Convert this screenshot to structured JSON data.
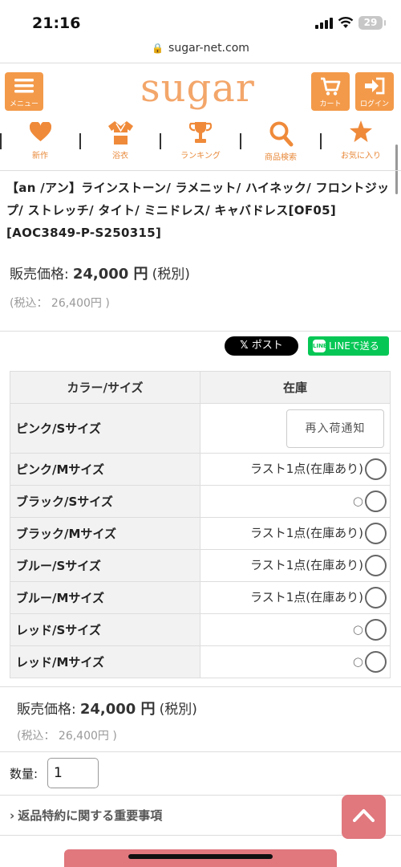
{
  "status_bar": {
    "time": "21:16",
    "battery": "29"
  },
  "browser": {
    "url": "sugar-net.com"
  },
  "header": {
    "menu_label": "メニュー",
    "logo": "sugar",
    "cart_label": "カート",
    "login_label": "ログイン"
  },
  "nav": {
    "items": [
      {
        "label": "新作",
        "icon": "heart-icon"
      },
      {
        "label": "浴衣",
        "icon": "yukata-icon"
      },
      {
        "label": "ランキング",
        "icon": "trophy-icon"
      },
      {
        "label": "商品検索",
        "icon": "search-icon"
      },
      {
        "label": "お気に入り",
        "icon": "star-icon"
      }
    ]
  },
  "product": {
    "title": "【an /アン】ラインストーン/ ラメニット/ ハイネック/ フロントジップ/ ストレッチ/ タイト/ ミニドレス/ キャバドレス[OF05][AOC3849-P-S250315]",
    "price_label": "販売価格:",
    "price": "24,000 円",
    "price_note": "(税別)",
    "tax_label": "(税込：",
    "tax_price": "26,400円",
    "tax_close": ")"
  },
  "share": {
    "x_post": "ポスト",
    "line": "LINEで送る"
  },
  "stock_table": {
    "headers": [
      "カラー/サイズ",
      "在庫"
    ],
    "rows": [
      {
        "name": "ピンク/Sサイズ",
        "stock": "",
        "button": "再入荷通知"
      },
      {
        "name": "ピンク/Mサイズ",
        "stock": "ラスト1点(在庫あり)"
      },
      {
        "name": "ブラック/Sサイズ",
        "stock": "○"
      },
      {
        "name": "ブラック/Mサイズ",
        "stock": "ラスト1点(在庫あり)"
      },
      {
        "name": "ブルー/Sサイズ",
        "stock": "ラスト1点(在庫あり)"
      },
      {
        "name": "ブルー/Mサイズ",
        "stock": "ラスト1点(在庫あり)"
      },
      {
        "name": "レッド/Sサイズ",
        "stock": "○"
      },
      {
        "name": "レッド/Mサイズ",
        "stock": "○"
      }
    ]
  },
  "order": {
    "qty_label": "数量:",
    "qty_value": "1",
    "returns_link": "返品特約に関する重要事項"
  },
  "colors": {
    "accent": "#f39a4a",
    "logo": "#f3a66a",
    "line": "#06c755",
    "totop": "#e0787e"
  }
}
